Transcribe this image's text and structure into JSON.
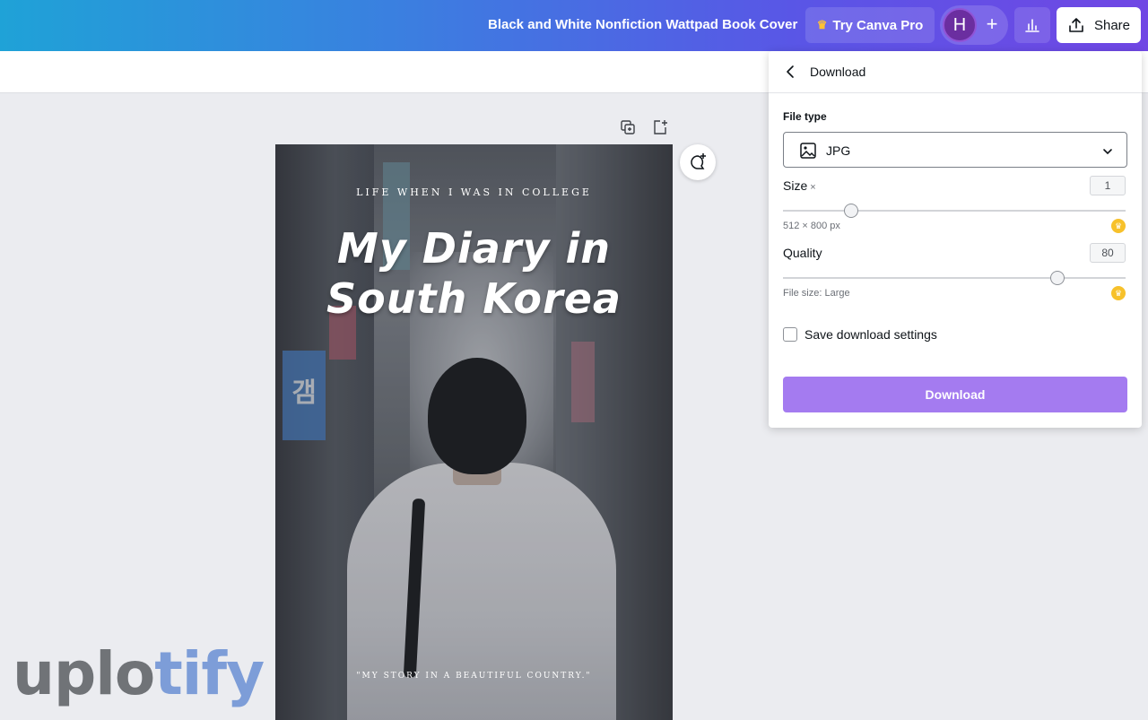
{
  "header": {
    "doc_title": "Black and White Nonfiction Wattpad Book Cover",
    "try_pro_label": "Try Canva Pro",
    "avatar_initial": "H",
    "add_label": "+",
    "share_label": "Share"
  },
  "cover": {
    "kicker": "LIFE WHEN I WAS IN COLLEGE",
    "title_line1": "My Diary in",
    "title_line2": "South Korea",
    "tagline": "\"MY STORY IN A BEAUTIFUL COUNTRY.\"",
    "sign_text": "갬"
  },
  "download_panel": {
    "title": "Download",
    "file_type_label": "File type",
    "file_type_value": "JPG",
    "size_label": "Size",
    "size_mark": "×",
    "size_value": "1",
    "size_slider_fraction": 0.2,
    "size_hint": "512 × 800 px",
    "quality_label": "Quality",
    "quality_value": "80",
    "quality_slider_fraction": 0.8,
    "quality_hint": "File size: Large",
    "save_settings_label": "Save download settings",
    "save_settings_checked": false,
    "download_button": "Download"
  },
  "watermark": {
    "part1": "uplo",
    "part2": "tify"
  },
  "colors": {
    "accent": "#a47bf0",
    "pro_crown": "#f7c12b",
    "avatar": "#6b2ea0"
  },
  "icons": {
    "crown": "crown-icon",
    "back": "chevron-left-icon",
    "image": "image-icon",
    "dropdown": "chevron-down-icon",
    "share": "share-upload-icon",
    "stats": "bar-chart-icon",
    "comment": "add-comment-icon",
    "duplicate": "duplicate-page-icon",
    "add_page": "add-page-icon"
  }
}
